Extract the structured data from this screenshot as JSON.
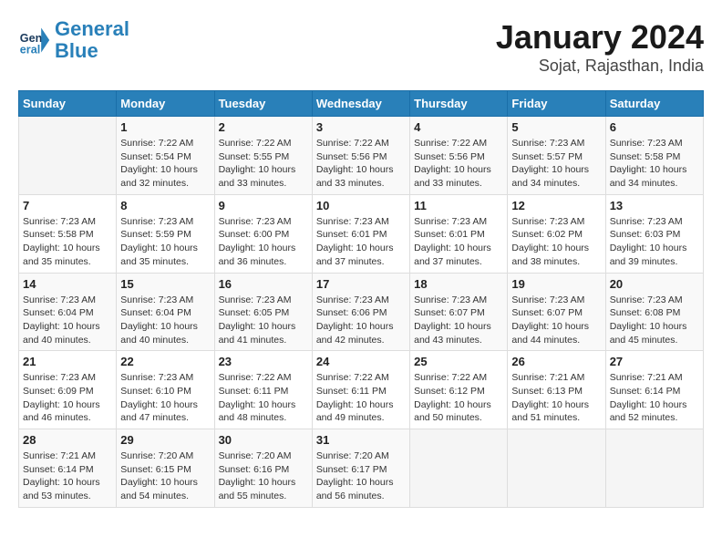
{
  "logo": {
    "line1": "General",
    "line2": "Blue"
  },
  "title": "January 2024",
  "subtitle": "Sojat, Rajasthan, India",
  "days_of_week": [
    "Sunday",
    "Monday",
    "Tuesday",
    "Wednesday",
    "Thursday",
    "Friday",
    "Saturday"
  ],
  "weeks": [
    [
      {
        "day": "",
        "info": ""
      },
      {
        "day": "1",
        "info": "Sunrise: 7:22 AM\nSunset: 5:54 PM\nDaylight: 10 hours\nand 32 minutes."
      },
      {
        "day": "2",
        "info": "Sunrise: 7:22 AM\nSunset: 5:55 PM\nDaylight: 10 hours\nand 33 minutes."
      },
      {
        "day": "3",
        "info": "Sunrise: 7:22 AM\nSunset: 5:56 PM\nDaylight: 10 hours\nand 33 minutes."
      },
      {
        "day": "4",
        "info": "Sunrise: 7:22 AM\nSunset: 5:56 PM\nDaylight: 10 hours\nand 33 minutes."
      },
      {
        "day": "5",
        "info": "Sunrise: 7:23 AM\nSunset: 5:57 PM\nDaylight: 10 hours\nand 34 minutes."
      },
      {
        "day": "6",
        "info": "Sunrise: 7:23 AM\nSunset: 5:58 PM\nDaylight: 10 hours\nand 34 minutes."
      }
    ],
    [
      {
        "day": "7",
        "info": "Sunrise: 7:23 AM\nSunset: 5:58 PM\nDaylight: 10 hours\nand 35 minutes."
      },
      {
        "day": "8",
        "info": "Sunrise: 7:23 AM\nSunset: 5:59 PM\nDaylight: 10 hours\nand 35 minutes."
      },
      {
        "day": "9",
        "info": "Sunrise: 7:23 AM\nSunset: 6:00 PM\nDaylight: 10 hours\nand 36 minutes."
      },
      {
        "day": "10",
        "info": "Sunrise: 7:23 AM\nSunset: 6:01 PM\nDaylight: 10 hours\nand 37 minutes."
      },
      {
        "day": "11",
        "info": "Sunrise: 7:23 AM\nSunset: 6:01 PM\nDaylight: 10 hours\nand 37 minutes."
      },
      {
        "day": "12",
        "info": "Sunrise: 7:23 AM\nSunset: 6:02 PM\nDaylight: 10 hours\nand 38 minutes."
      },
      {
        "day": "13",
        "info": "Sunrise: 7:23 AM\nSunset: 6:03 PM\nDaylight: 10 hours\nand 39 minutes."
      }
    ],
    [
      {
        "day": "14",
        "info": "Sunrise: 7:23 AM\nSunset: 6:04 PM\nDaylight: 10 hours\nand 40 minutes."
      },
      {
        "day": "15",
        "info": "Sunrise: 7:23 AM\nSunset: 6:04 PM\nDaylight: 10 hours\nand 40 minutes."
      },
      {
        "day": "16",
        "info": "Sunrise: 7:23 AM\nSunset: 6:05 PM\nDaylight: 10 hours\nand 41 minutes."
      },
      {
        "day": "17",
        "info": "Sunrise: 7:23 AM\nSunset: 6:06 PM\nDaylight: 10 hours\nand 42 minutes."
      },
      {
        "day": "18",
        "info": "Sunrise: 7:23 AM\nSunset: 6:07 PM\nDaylight: 10 hours\nand 43 minutes."
      },
      {
        "day": "19",
        "info": "Sunrise: 7:23 AM\nSunset: 6:07 PM\nDaylight: 10 hours\nand 44 minutes."
      },
      {
        "day": "20",
        "info": "Sunrise: 7:23 AM\nSunset: 6:08 PM\nDaylight: 10 hours\nand 45 minutes."
      }
    ],
    [
      {
        "day": "21",
        "info": "Sunrise: 7:23 AM\nSunset: 6:09 PM\nDaylight: 10 hours\nand 46 minutes."
      },
      {
        "day": "22",
        "info": "Sunrise: 7:23 AM\nSunset: 6:10 PM\nDaylight: 10 hours\nand 47 minutes."
      },
      {
        "day": "23",
        "info": "Sunrise: 7:22 AM\nSunset: 6:11 PM\nDaylight: 10 hours\nand 48 minutes."
      },
      {
        "day": "24",
        "info": "Sunrise: 7:22 AM\nSunset: 6:11 PM\nDaylight: 10 hours\nand 49 minutes."
      },
      {
        "day": "25",
        "info": "Sunrise: 7:22 AM\nSunset: 6:12 PM\nDaylight: 10 hours\nand 50 minutes."
      },
      {
        "day": "26",
        "info": "Sunrise: 7:21 AM\nSunset: 6:13 PM\nDaylight: 10 hours\nand 51 minutes."
      },
      {
        "day": "27",
        "info": "Sunrise: 7:21 AM\nSunset: 6:14 PM\nDaylight: 10 hours\nand 52 minutes."
      }
    ],
    [
      {
        "day": "28",
        "info": "Sunrise: 7:21 AM\nSunset: 6:14 PM\nDaylight: 10 hours\nand 53 minutes."
      },
      {
        "day": "29",
        "info": "Sunrise: 7:20 AM\nSunset: 6:15 PM\nDaylight: 10 hours\nand 54 minutes."
      },
      {
        "day": "30",
        "info": "Sunrise: 7:20 AM\nSunset: 6:16 PM\nDaylight: 10 hours\nand 55 minutes."
      },
      {
        "day": "31",
        "info": "Sunrise: 7:20 AM\nSunset: 6:17 PM\nDaylight: 10 hours\nand 56 minutes."
      },
      {
        "day": "",
        "info": ""
      },
      {
        "day": "",
        "info": ""
      },
      {
        "day": "",
        "info": ""
      }
    ]
  ]
}
